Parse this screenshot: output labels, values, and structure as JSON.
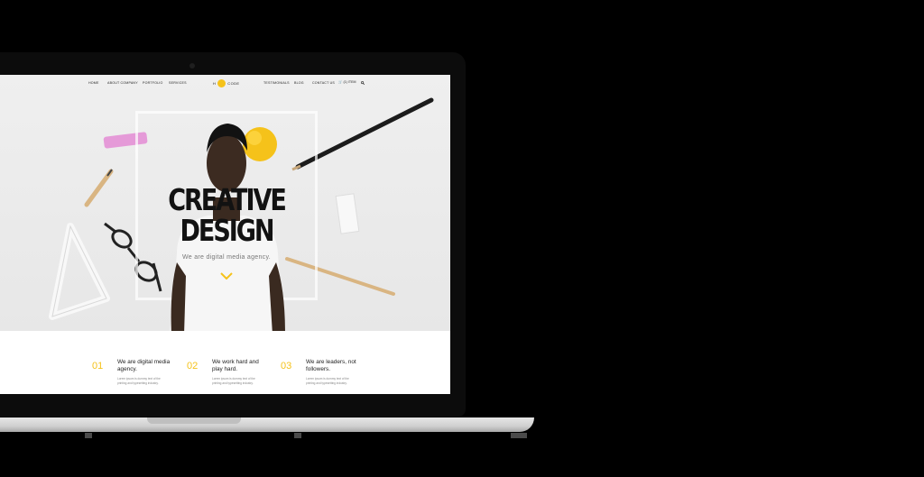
{
  "nav": {
    "left": [
      "HOME",
      "ABOUT COMPANY",
      "PORTFOLIO",
      "SERVICES"
    ],
    "logo_left": "H",
    "logo_right": "CODE",
    "right": [
      "TESTIMONIALS",
      "BLOG",
      "CONTACT US"
    ],
    "cart": "(1) ITEM"
  },
  "hero": {
    "title_line1": "CREATIVE",
    "title_line2": "DESIGN",
    "subtitle": "We are digital media agency."
  },
  "features": [
    {
      "num": "01",
      "head": "We are digital media agency.",
      "body": "Lorem ipsum is dummy text of the printing and typesetting industry."
    },
    {
      "num": "02",
      "head": "We work hard and play hard.",
      "body": "Lorem ipsum is dummy text of the printing and typesetting industry."
    },
    {
      "num": "03",
      "head": "We are leaders, not followers.",
      "body": "Lorem ipsum is dummy text of the printing and typesetting industry."
    }
  ],
  "colors": {
    "accent": "#f5c21a",
    "eraser": "#e59ad8",
    "background": "#000000"
  },
  "icons": [
    "camera-icon",
    "cart-icon",
    "search-icon",
    "chevron-down-icon"
  ]
}
